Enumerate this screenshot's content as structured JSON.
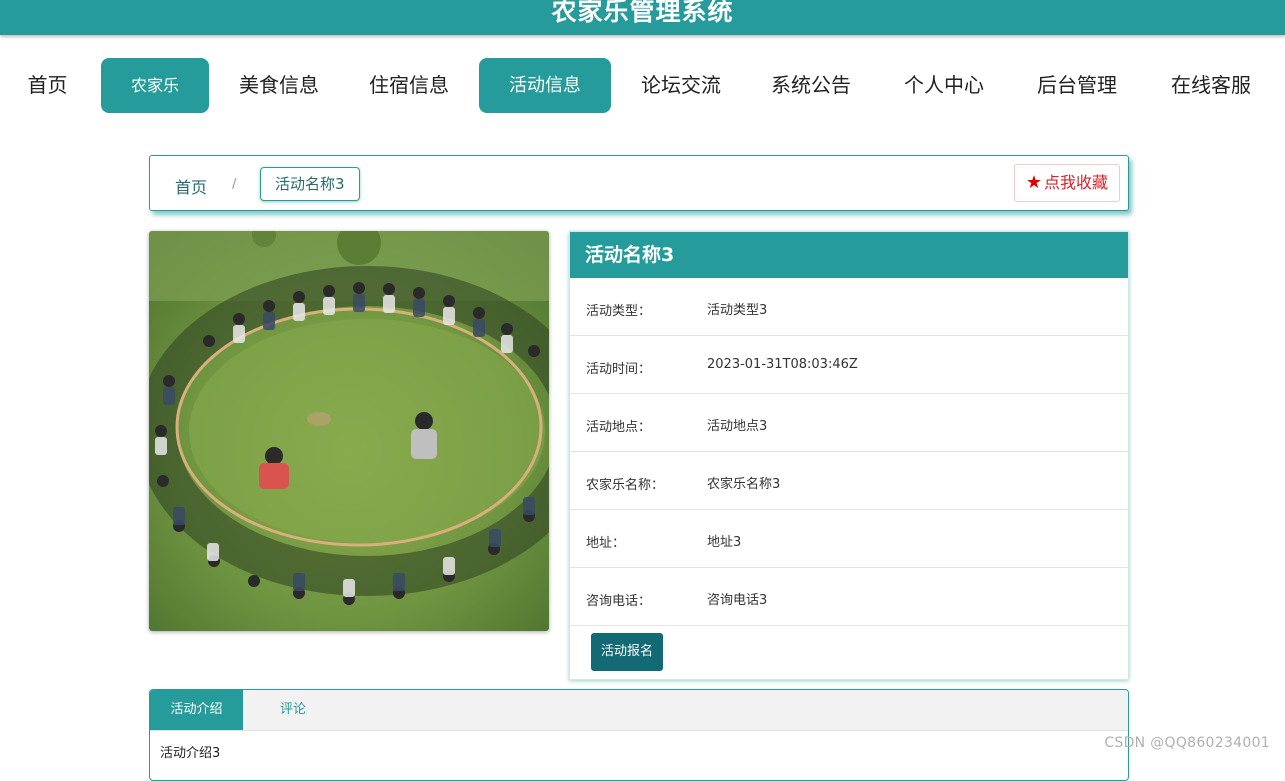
{
  "header": {
    "title": "农家乐管理系统"
  },
  "nav": {
    "items": [
      {
        "label": "首页"
      },
      {
        "label": "农家乐"
      },
      {
        "label": "美食信息"
      },
      {
        "label": "住宿信息"
      },
      {
        "label": "活动信息"
      },
      {
        "label": "论坛交流"
      },
      {
        "label": "系统公告"
      },
      {
        "label": "个人中心"
      },
      {
        "label": "后台管理"
      },
      {
        "label": "在线客服"
      }
    ]
  },
  "breadcrumb": {
    "home": "首页",
    "separator": "/",
    "current": "活动名称3"
  },
  "favorite": {
    "icon": "star-icon",
    "label": "点我收藏"
  },
  "detail": {
    "title": "活动名称3",
    "rows": [
      {
        "label": "活动类型：",
        "value": "活动类型3"
      },
      {
        "label": "活动时间：",
        "value": "2023-01-31T08:03:46Z"
      },
      {
        "label": "活动地点：",
        "value": "活动地点3"
      },
      {
        "label": "农家乐名称：",
        "value": "农家乐名称3"
      },
      {
        "label": "地址：",
        "value": "地址3"
      },
      {
        "label": "咨询电话：",
        "value": "咨询电话3"
      }
    ],
    "signup_label": "活动报名"
  },
  "tabs": {
    "items": [
      {
        "label": "活动介绍"
      },
      {
        "label": "评论"
      }
    ],
    "content": "活动介绍3"
  },
  "watermark": "CSDN @QQ860234001",
  "colors": {
    "primary": "#259b9b",
    "button_dark": "#126b74",
    "favorite_red": "#e00000"
  }
}
